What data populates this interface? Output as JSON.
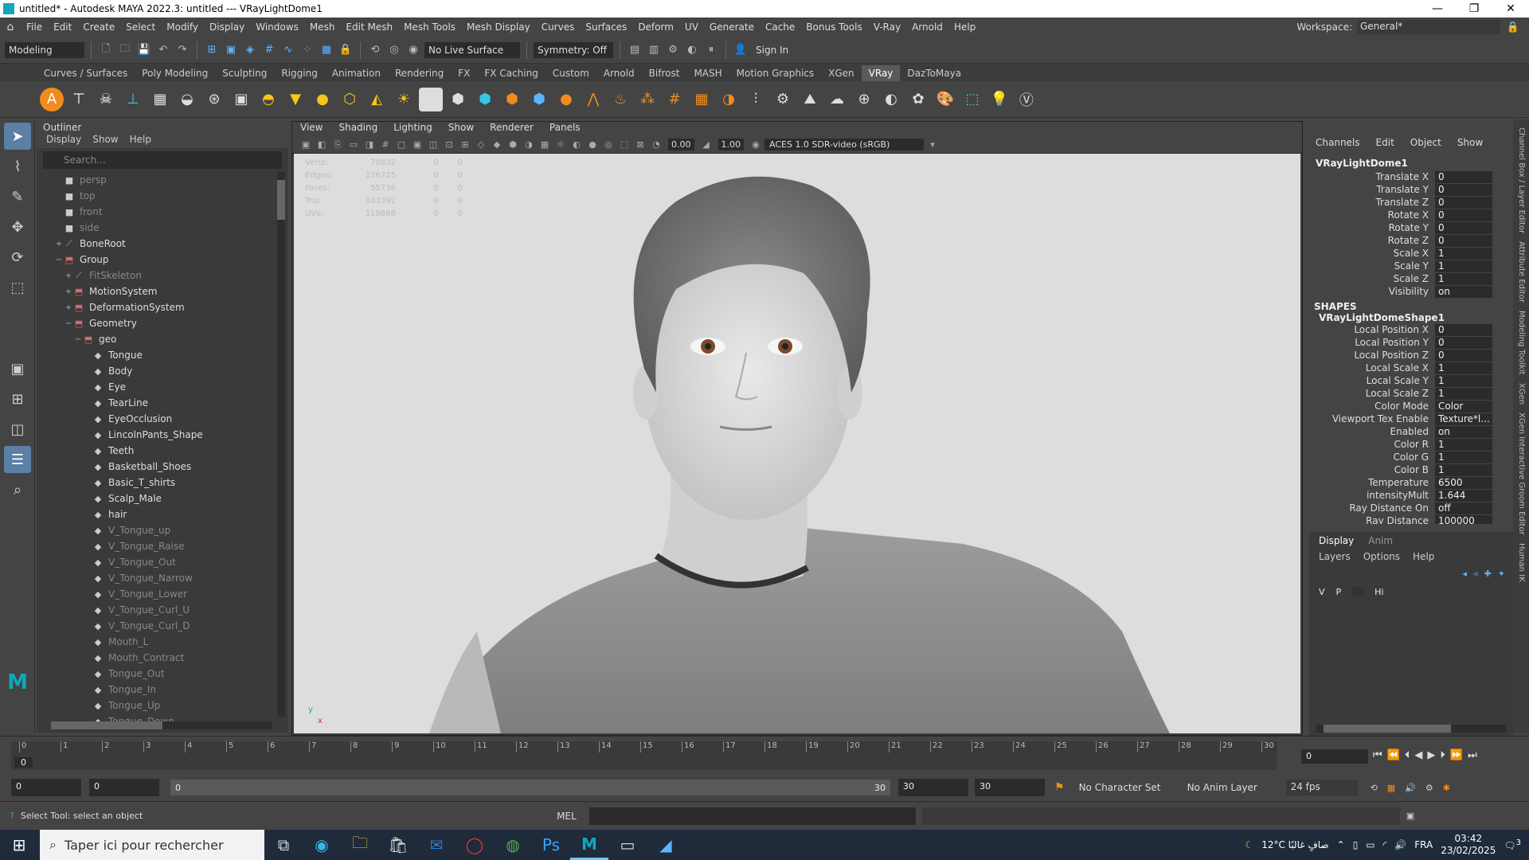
{
  "window": {
    "title": "untitled* - Autodesk MAYA 2022.3: untitled   ---   VRayLightDome1",
    "minimize": "—",
    "restore": "❐",
    "close": "✕"
  },
  "menubar": {
    "items": [
      "File",
      "Edit",
      "Create",
      "Select",
      "Modify",
      "Display",
      "Windows",
      "Mesh",
      "Edit Mesh",
      "Mesh Tools",
      "Mesh Display",
      "Curves",
      "Surfaces",
      "Deform",
      "UV",
      "Generate",
      "Cache",
      "Bonus Tools",
      "V-Ray",
      "Arnold",
      "Help"
    ],
    "workspace_label": "Workspace:",
    "workspace_value": "General*"
  },
  "statusline": {
    "menuset": "Modeling",
    "live_surface": "No Live Surface",
    "symmetry": "Symmetry: Off",
    "sign_in": "Sign In"
  },
  "shelf": {
    "tabs": [
      "Curves / Surfaces",
      "Poly Modeling",
      "Sculpting",
      "Rigging",
      "Animation",
      "Rendering",
      "FX",
      "FX Caching",
      "Custom",
      "Arnold",
      "Bifrost",
      "MASH",
      "Motion Graphics",
      "XGen",
      "VRay",
      "DazToMaya"
    ],
    "active_tab": "VRay"
  },
  "outliner": {
    "title": "Outliner",
    "menu": [
      "Display",
      "Show",
      "Help"
    ],
    "search_placeholder": "Search...",
    "rows": [
      {
        "label": "persp",
        "indent": 0,
        "dim": true,
        "exp": "",
        "kind": "camera"
      },
      {
        "label": "top",
        "indent": 0,
        "dim": true,
        "exp": "",
        "kind": "camera"
      },
      {
        "label": "front",
        "indent": 0,
        "dim": true,
        "exp": "",
        "kind": "camera"
      },
      {
        "label": "side",
        "indent": 0,
        "dim": true,
        "exp": "",
        "kind": "camera"
      },
      {
        "label": "BoneRoot",
        "indent": 0,
        "dim": false,
        "exp": "+",
        "kind": "joint"
      },
      {
        "label": "Group",
        "indent": 0,
        "dim": false,
        "exp": "−",
        "kind": "group"
      },
      {
        "label": "FitSkeleton",
        "indent": 1,
        "dim": true,
        "exp": "+",
        "kind": "joint"
      },
      {
        "label": "MotionSystem",
        "indent": 1,
        "dim": false,
        "exp": "+",
        "kind": "group"
      },
      {
        "label": "DeformationSystem",
        "indent": 1,
        "dim": false,
        "exp": "+",
        "kind": "group"
      },
      {
        "label": "Geometry",
        "indent": 1,
        "dim": false,
        "exp": "−",
        "kind": "group"
      },
      {
        "label": "geo",
        "indent": 2,
        "dim": false,
        "exp": "−",
        "kind": "group"
      },
      {
        "label": "Tongue",
        "indent": 3,
        "dim": false,
        "exp": "",
        "kind": "mesh"
      },
      {
        "label": "Body",
        "indent": 3,
        "dim": false,
        "exp": "",
        "kind": "mesh"
      },
      {
        "label": "Eye",
        "indent": 3,
        "dim": false,
        "exp": "",
        "kind": "mesh"
      },
      {
        "label": "TearLine",
        "indent": 3,
        "dim": false,
        "exp": "",
        "kind": "mesh"
      },
      {
        "label": "EyeOcclusion",
        "indent": 3,
        "dim": false,
        "exp": "",
        "kind": "mesh"
      },
      {
        "label": "LincolnPants_Shape",
        "indent": 3,
        "dim": false,
        "exp": "",
        "kind": "mesh"
      },
      {
        "label": "Teeth",
        "indent": 3,
        "dim": false,
        "exp": "",
        "kind": "mesh"
      },
      {
        "label": "Basketball_Shoes",
        "indent": 3,
        "dim": false,
        "exp": "",
        "kind": "mesh"
      },
      {
        "label": "Basic_T_shirts",
        "indent": 3,
        "dim": false,
        "exp": "",
        "kind": "mesh"
      },
      {
        "label": "Scalp_Male",
        "indent": 3,
        "dim": false,
        "exp": "",
        "kind": "mesh"
      },
      {
        "label": "hair",
        "indent": 3,
        "dim": false,
        "exp": "",
        "kind": "mesh"
      },
      {
        "label": "V_Tongue_up",
        "indent": 3,
        "dim": true,
        "exp": "",
        "kind": "mesh"
      },
      {
        "label": "V_Tongue_Raise",
        "indent": 3,
        "dim": true,
        "exp": "",
        "kind": "mesh"
      },
      {
        "label": "V_Tongue_Out",
        "indent": 3,
        "dim": true,
        "exp": "",
        "kind": "mesh"
      },
      {
        "label": "V_Tongue_Narrow",
        "indent": 3,
        "dim": true,
        "exp": "",
        "kind": "mesh"
      },
      {
        "label": "V_Tongue_Lower",
        "indent": 3,
        "dim": true,
        "exp": "",
        "kind": "mesh"
      },
      {
        "label": "V_Tongue_Curl_U",
        "indent": 3,
        "dim": true,
        "exp": "",
        "kind": "mesh"
      },
      {
        "label": "V_Tongue_Curl_D",
        "indent": 3,
        "dim": true,
        "exp": "",
        "kind": "mesh"
      },
      {
        "label": "Mouth_L",
        "indent": 3,
        "dim": true,
        "exp": "",
        "kind": "mesh"
      },
      {
        "label": "Mouth_Contract",
        "indent": 3,
        "dim": true,
        "exp": "",
        "kind": "mesh"
      },
      {
        "label": "Tongue_Out",
        "indent": 3,
        "dim": true,
        "exp": "",
        "kind": "mesh"
      },
      {
        "label": "Tongue_In",
        "indent": 3,
        "dim": true,
        "exp": "",
        "kind": "mesh"
      },
      {
        "label": "Tongue_Up",
        "indent": 3,
        "dim": true,
        "exp": "",
        "kind": "mesh"
      },
      {
        "label": "Tongue_Down",
        "indent": 3,
        "dim": true,
        "exp": "",
        "kind": "mesh"
      }
    ]
  },
  "viewport": {
    "menu": [
      "View",
      "Shading",
      "Lighting",
      "Show",
      "Renderer",
      "Panels"
    ],
    "exposure": "0.00",
    "gamma": "1.00",
    "colorspace": "ACES 1.0 SDR-video (sRGB)",
    "hud": [
      {
        "label": "Verts:",
        "value": "70832",
        "a": "0",
        "b": "0"
      },
      {
        "label": "Edges:",
        "value": "126725",
        "a": "0",
        "b": "0"
      },
      {
        "label": "Faces:",
        "value": "55736",
        "a": "0",
        "b": "0"
      },
      {
        "label": "Tris:",
        "value": "103392",
        "a": "0",
        "b": "0"
      },
      {
        "label": "UVs:",
        "value": "119888",
        "a": "0",
        "b": "0"
      }
    ],
    "axis_y": "y",
    "axis_x": "x"
  },
  "channelbox": {
    "menu": [
      "Channels",
      "Edit",
      "Object",
      "Show"
    ],
    "node": "VRayLightDome1",
    "transform": [
      {
        "name": "Translate X",
        "value": "0"
      },
      {
        "name": "Translate Y",
        "value": "0"
      },
      {
        "name": "Translate Z",
        "value": "0"
      },
      {
        "name": "Rotate X",
        "value": "0"
      },
      {
        "name": "Rotate Y",
        "value": "0"
      },
      {
        "name": "Rotate Z",
        "value": "0"
      },
      {
        "name": "Scale X",
        "value": "1"
      },
      {
        "name": "Scale Y",
        "value": "1"
      },
      {
        "name": "Scale Z",
        "value": "1"
      },
      {
        "name": "Visibility",
        "value": "on"
      }
    ],
    "shapes_label": "SHAPES",
    "shape_node": "VRayLightDomeShape1",
    "shape_attrs": [
      {
        "name": "Local Position X",
        "value": "0"
      },
      {
        "name": "Local Position Y",
        "value": "0"
      },
      {
        "name": "Local Position Z",
        "value": "0"
      },
      {
        "name": "Local Scale X",
        "value": "1"
      },
      {
        "name": "Local Scale Y",
        "value": "1"
      },
      {
        "name": "Local Scale Z",
        "value": "1"
      },
      {
        "name": "Color Mode",
        "value": "Color"
      },
      {
        "name": "Viewport Tex Enable",
        "value": "Texture*l..."
      },
      {
        "name": "Enabled",
        "value": "on"
      },
      {
        "name": "Color R",
        "value": "1"
      },
      {
        "name": "Color G",
        "value": "1"
      },
      {
        "name": "Color B",
        "value": "1"
      },
      {
        "name": "Temperature",
        "value": "6500"
      },
      {
        "name": "intensityMult",
        "value": "1.644"
      },
      {
        "name": "Ray Distance On",
        "value": "off"
      },
      {
        "name": "Ray Distance",
        "value": "100000"
      }
    ]
  },
  "layer_editor": {
    "tabs": [
      "Display",
      "Anim"
    ],
    "menu": [
      "Layers",
      "Options",
      "Help"
    ],
    "cols": [
      "V",
      "P"
    ],
    "hi": "Hi"
  },
  "side_tabs": [
    "Channel Box / Layer Editor",
    "Attribute Editor",
    "Modeling Toolkit",
    "XGen",
    "XGen Interactive Groom Editor",
    "Human IK"
  ],
  "timeline": {
    "ticks": [
      "0",
      "1",
      "2",
      "3",
      "4",
      "5",
      "6",
      "7",
      "8",
      "9",
      "10",
      "11",
      "12",
      "13",
      "14",
      "15",
      "16",
      "17",
      "18",
      "19",
      "20",
      "21",
      "22",
      "23",
      "24",
      "25",
      "26",
      "27",
      "28",
      "29",
      "30"
    ],
    "current": "0",
    "current_field": "0"
  },
  "rangebar": {
    "start": "0",
    "playstart": "0",
    "slider_start": "0",
    "slider_end": "30",
    "playend": "30",
    "end": "30",
    "character_set": "No Character Set",
    "anim_layer": "No Anim Layer",
    "fps": "24 fps"
  },
  "cmdline": {
    "help": "Select Tool: select an object",
    "lang": "MEL"
  },
  "taskbar": {
    "search_placeholder": "Taper ici pour rechercher",
    "weather": "12°C  صافٍ غالبًا",
    "lang": "FRA",
    "time": "03:42",
    "date": "23/02/2025",
    "notifications": "3"
  },
  "colors": {
    "accent": "#5b7fa5",
    "viewport_bg": "#dddddd",
    "maya_teal": "#10a7b8"
  }
}
